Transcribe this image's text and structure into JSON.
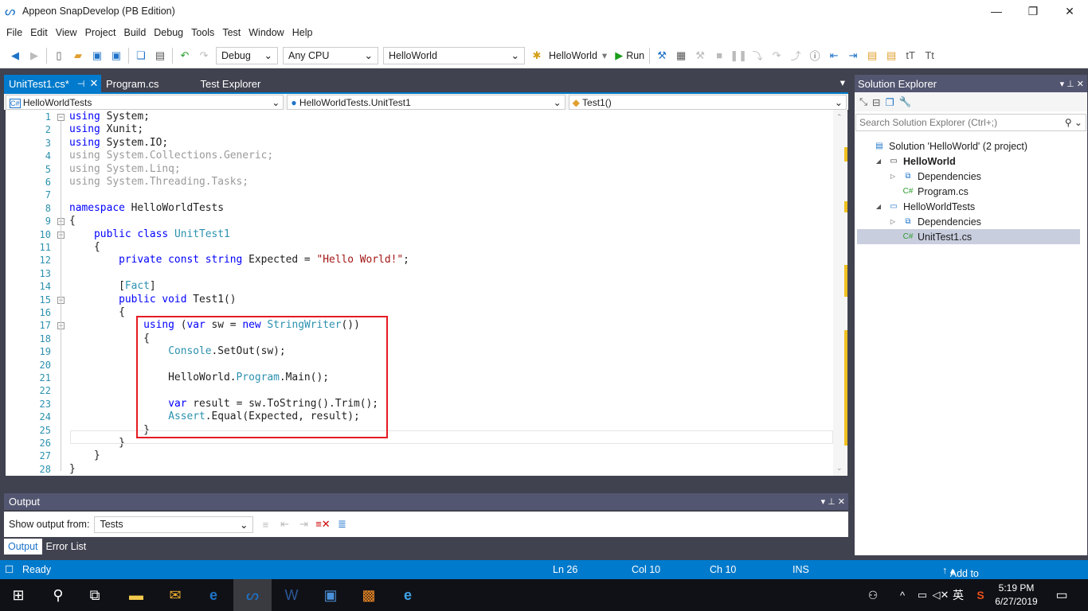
{
  "window": {
    "title": "Appeon SnapDevelop (PB Edition)"
  },
  "menu": [
    "File",
    "Edit",
    "View",
    "Project",
    "Build",
    "Debug",
    "Tools",
    "Test",
    "Window",
    "Help"
  ],
  "toolbar": {
    "config": "Debug",
    "platform": "Any CPU",
    "project": "HelloWorld",
    "startup": "HelloWorld",
    "run": "Run"
  },
  "tabs": [
    {
      "label": "UnitTest1.cs*",
      "active": true
    },
    {
      "label": "Program.cs"
    },
    {
      "label": "Test Explorer"
    }
  ],
  "navbar": {
    "project": "HelloWorldTests",
    "class": "HelloWorldTests.UnitTest1",
    "member": "Test1()"
  },
  "code": [
    [
      [
        "using",
        "k"
      ],
      [
        " System;",
        "n"
      ]
    ],
    [
      [
        "using",
        "k"
      ],
      [
        " Xunit;",
        "n"
      ]
    ],
    [
      [
        "using",
        "k"
      ],
      [
        " System.IO;",
        "n"
      ]
    ],
    [
      [
        "using System.Collections.Generic;",
        "g"
      ]
    ],
    [
      [
        "using System.Linq;",
        "g"
      ]
    ],
    [
      [
        "using System.Threading.Tasks;",
        "g"
      ]
    ],
    [],
    [
      [
        "namespace",
        "k"
      ],
      [
        " HelloWorldTests",
        "n"
      ]
    ],
    [
      [
        "{",
        "n"
      ]
    ],
    [
      [
        "    public class ",
        "k"
      ],
      [
        "UnitTest1",
        "ty"
      ]
    ],
    [
      [
        "    {",
        "n"
      ]
    ],
    [
      [
        "        private const string",
        "k"
      ],
      [
        " Expected = ",
        "n"
      ],
      [
        "\"Hello World!\"",
        "s"
      ],
      [
        ";",
        "n"
      ]
    ],
    [],
    [
      [
        "        [",
        "n"
      ],
      [
        "Fact",
        "ty"
      ],
      [
        "]",
        "n"
      ]
    ],
    [
      [
        "        public void",
        "k"
      ],
      [
        " Test1()",
        "n"
      ]
    ],
    [
      [
        "        {",
        "n"
      ]
    ],
    [
      [
        "            using",
        "k"
      ],
      [
        " (",
        "n"
      ],
      [
        "var",
        "k"
      ],
      [
        " sw = ",
        "n"
      ],
      [
        "new",
        "k"
      ],
      [
        " ",
        "n"
      ],
      [
        "StringWriter",
        "ty"
      ],
      [
        "())",
        "n"
      ]
    ],
    [
      [
        "            {",
        "n"
      ]
    ],
    [
      [
        "                ",
        "n"
      ],
      [
        "Console",
        "ty"
      ],
      [
        ".SetOut(sw);",
        "n"
      ]
    ],
    [],
    [
      [
        "                HelloWorld.",
        "n"
      ],
      [
        "Program",
        "ty"
      ],
      [
        ".Main();",
        "n"
      ]
    ],
    [],
    [
      [
        "                ",
        "n"
      ],
      [
        "var",
        "k"
      ],
      [
        " result = sw.ToString().Trim();",
        "n"
      ]
    ],
    [
      [
        "                ",
        "n"
      ],
      [
        "Assert",
        "ty"
      ],
      [
        ".Equal(Expected, result);",
        "n"
      ]
    ],
    [
      [
        "            }",
        "n"
      ]
    ],
    [
      [
        "        }",
        "n"
      ]
    ],
    [
      [
        "    }",
        "n"
      ]
    ],
    [
      [
        "}",
        "n"
      ]
    ]
  ],
  "output": {
    "title": "Output",
    "show_from_label": "Show output from:",
    "source": "Tests",
    "tabs": [
      "Output",
      "Error List"
    ]
  },
  "solution_explorer": {
    "title": "Solution Explorer",
    "search_placeholder": "Search Solution Explorer (Ctrl+;)",
    "items": [
      "Solution 'HelloWorld' (2 project)",
      "HelloWorld",
      "Dependencies",
      "Program.cs",
      "HelloWorldTests",
      "Dependencies",
      "UnitTest1.cs"
    ]
  },
  "status": {
    "state": "Ready",
    "ln": "Ln 26",
    "col": "Col 10",
    "ch": "Ch 10",
    "mode": "INS",
    "source_control": "Add to Source Control"
  },
  "taskbar": {
    "time": "5:19 PM",
    "date": "6/27/2019",
    "ime": "英"
  },
  "colors": {
    "accent": "#007acc",
    "keyword": "#0000ff",
    "type": "#2b91af",
    "string": "#a31515",
    "highlight_box": "#e51b23"
  }
}
